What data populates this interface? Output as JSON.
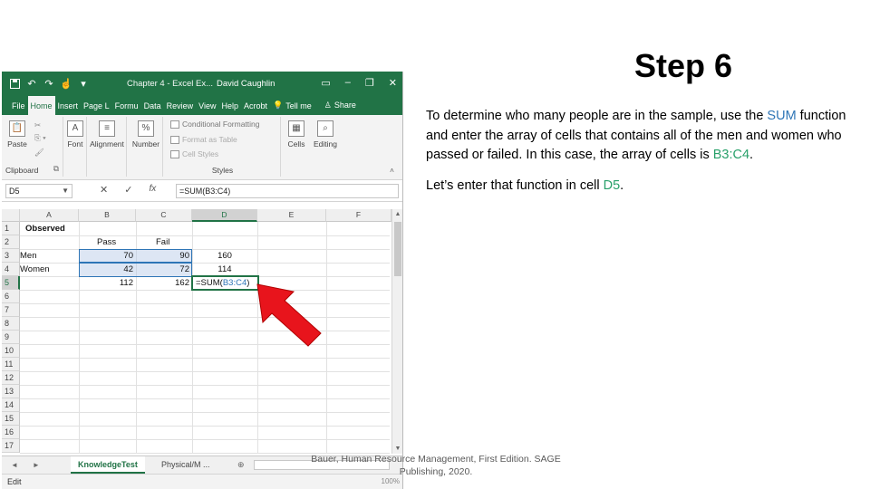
{
  "slide": {
    "title": "Step 6",
    "para1": {
      "a": "To determine who many people are in the sample, use the ",
      "sum": "SUM",
      "b": " function and enter the array of cells that contains all of the men and women who passed or failed. In this case, the array of cells is ",
      "range": "B3:C4",
      "c": "."
    },
    "para2": {
      "a": "Let’s enter that function in cell ",
      "cell": "D5",
      "b": "."
    },
    "footer": "Bauer, Human Resource Management, First Edition. SAGE Publishing, 2020."
  },
  "excel": {
    "doc_title": "Chapter 4 - Excel Ex...",
    "user": "David Caughlin",
    "tabs": [
      "File",
      "Home",
      "Insert",
      "Page L",
      "Formu",
      "Data",
      "Review",
      "View",
      "Help",
      "Acrobt"
    ],
    "tell_me": "Tell me",
    "share": "Share",
    "ribbon": {
      "paste": "Paste",
      "clipboard": "Clipboard",
      "font": "Font",
      "alignment": "Alignment",
      "number": "Number",
      "cond_format": "Conditional Formatting",
      "format_table": "Format as Table",
      "cell_styles": "Cell Styles",
      "styles": "Styles",
      "cells": "Cells",
      "editing": "Editing"
    },
    "name_box": "D5",
    "formula": "=SUM(B3:C4)",
    "columns": [
      "A",
      "B",
      "C",
      "D",
      "E",
      "F"
    ],
    "rows": [
      "1",
      "2",
      "3",
      "4",
      "5",
      "6",
      "7",
      "8",
      "9",
      "10",
      "11",
      "12",
      "13",
      "14",
      "15",
      "16",
      "17"
    ],
    "cells": {
      "a1": "Observed",
      "b2": "Pass",
      "c2": "Fail",
      "a3": "Men",
      "b3": "70",
      "c3": "90",
      "d3": "160",
      "a4": "Women",
      "b4": "42",
      "c4": "72",
      "d4": "114",
      "b5": "112",
      "c5": "162",
      "d5_a": "=SUM(",
      "d5_b": "B3:C4",
      "d5_c": ")"
    },
    "sheet_tabs": [
      "KnowledgeTest",
      "Physical/M ..."
    ],
    "status": "Edit",
    "zoom": "100%"
  },
  "colors": {
    "excel_green": "#217346",
    "highlight_blue": "#2e75b6",
    "highlight_green": "#28a06a",
    "arrow_red": "#e8141c"
  }
}
